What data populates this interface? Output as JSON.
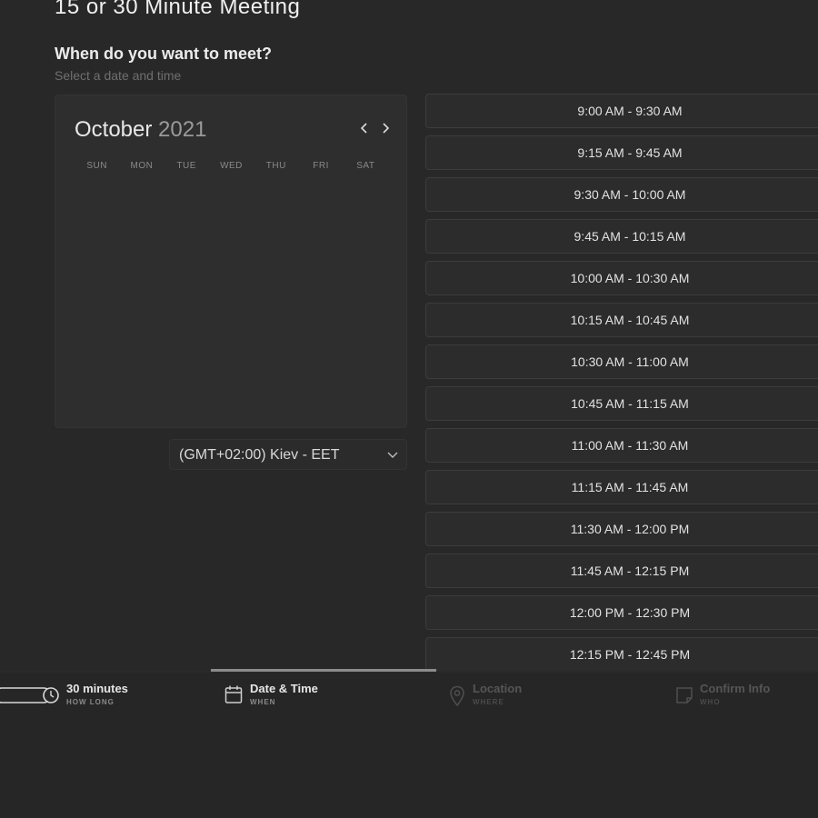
{
  "header": {
    "title": "15 or 30 Minute Meeting",
    "question": "When do you want to meet?",
    "subtitle": "Select a date and time"
  },
  "calendar": {
    "month": "October",
    "year": "2021",
    "weekdays": [
      "SUN",
      "MON",
      "TUE",
      "WED",
      "THU",
      "FRI",
      "SAT"
    ]
  },
  "timezone": {
    "label": "(GMT+02:00) Kiev - EET"
  },
  "time_slots": [
    "9:00 AM - 9:30 AM",
    "9:15 AM - 9:45 AM",
    "9:30 AM - 10:00 AM",
    "9:45 AM - 10:15 AM",
    "10:00 AM - 10:30 AM",
    "10:15 AM - 10:45 AM",
    "10:30 AM - 11:00 AM",
    "10:45 AM - 11:15 AM",
    "11:00 AM - 11:30 AM",
    "11:15 AM - 11:45 AM",
    "11:30 AM - 12:00 PM",
    "11:45 AM - 12:15 PM",
    "12:00 PM - 12:30 PM",
    "12:15 PM - 12:45 PM"
  ],
  "steps": [
    {
      "label": "30 minutes",
      "sub": "HOW LONG",
      "icon": "duration-icon",
      "state": "done"
    },
    {
      "label": "Date & Time",
      "sub": "WHEN",
      "icon": "calendar-icon",
      "state": "active"
    },
    {
      "label": "Location",
      "sub": "WHERE",
      "icon": "location-pin-icon",
      "state": "inactive"
    },
    {
      "label": "Confirm Info",
      "sub": "WHO",
      "icon": "note-icon",
      "state": "inactive"
    }
  ],
  "colors": {
    "background": "#282828",
    "panel": "#2e2e2e",
    "text": "#e6e6e6",
    "muted": "#6f6f6f"
  }
}
